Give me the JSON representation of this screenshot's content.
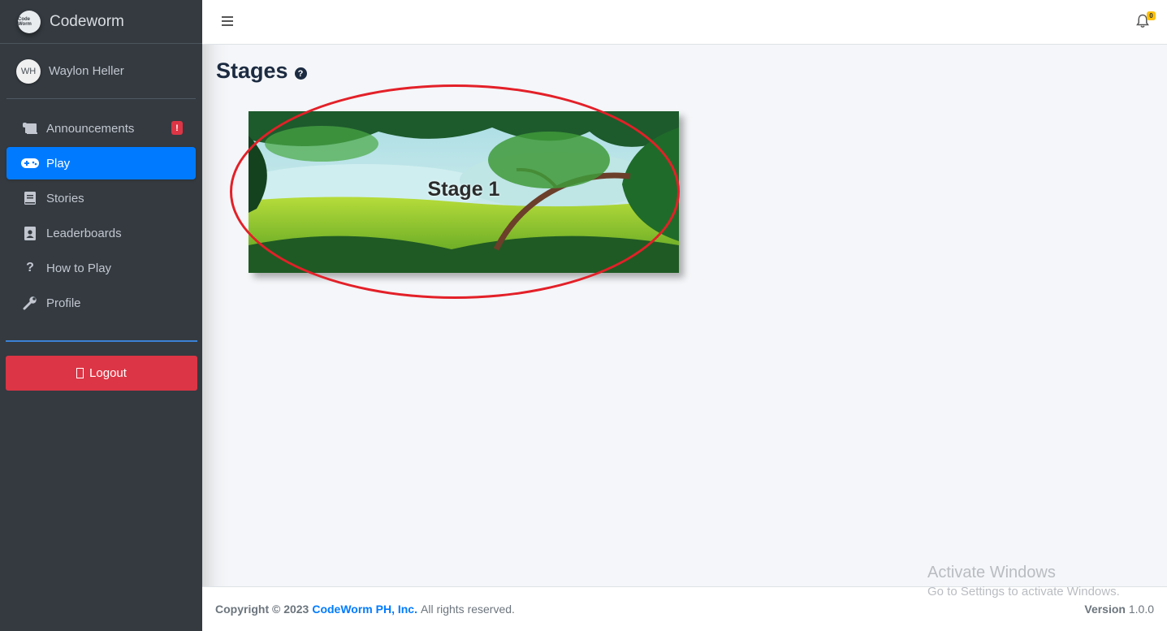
{
  "brand": {
    "name": "Codeworm",
    "logo_text": "Code Worm"
  },
  "user": {
    "initials": "WH",
    "name": "Waylon Heller"
  },
  "nav": {
    "items": [
      {
        "label": "Announcements",
        "icon": "scroll-icon",
        "badge": "!"
      },
      {
        "label": "Play",
        "icon": "gamepad-icon",
        "active": true
      },
      {
        "label": "Stories",
        "icon": "book-icon"
      },
      {
        "label": "Leaderboards",
        "icon": "clipboard-user-icon"
      },
      {
        "label": "How to Play",
        "icon": "question-icon"
      },
      {
        "label": "Profile",
        "icon": "wrench-icon"
      }
    ],
    "logout_label": "Logout"
  },
  "topbar": {
    "notification_count": "0"
  },
  "page": {
    "title": "Stages"
  },
  "stages": [
    {
      "label": "Stage 1"
    }
  ],
  "footer": {
    "copyright_prefix": "Copyright © 2023",
    "company": "CodeWorm PH, Inc.",
    "rights": "All rights reserved.",
    "version_label": "Version",
    "version_value": "1.0.0"
  },
  "watermark": {
    "line1": "Activate Windows",
    "line2": "Go to Settings to activate Windows."
  },
  "colors": {
    "sidebar": "#343a40",
    "active": "#007bff",
    "danger": "#dc3545",
    "highlight": "#e32028",
    "badge": "#ffc107"
  }
}
